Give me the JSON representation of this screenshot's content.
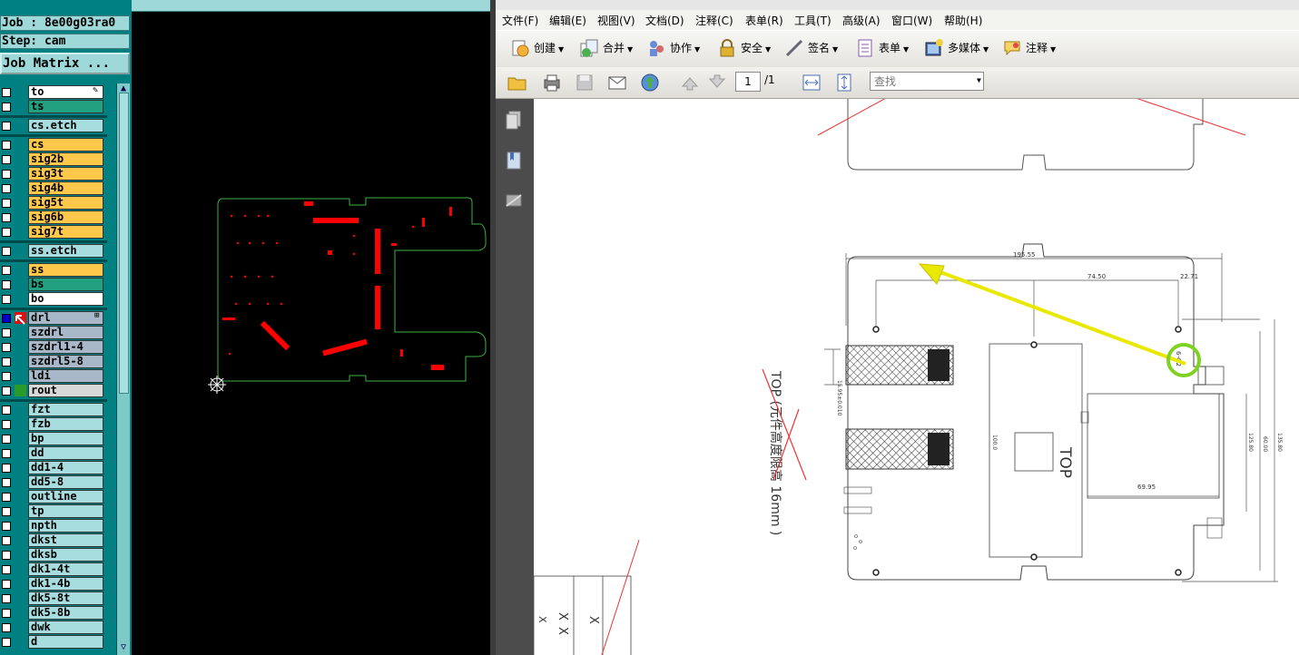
{
  "cam": {
    "job_label": "Job : 8e00g03ra0",
    "step_label": "Step: cam",
    "job_matrix_button": "Job Matrix ...",
    "layers": [
      {
        "name": "to",
        "color": "#ffffff",
        "checked": false,
        "extra": "pencil"
      },
      {
        "name": "ts",
        "color": "#22a080",
        "checked": false
      },
      {
        "name": "cs.etch",
        "color": "#a8dde0",
        "checked": false
      },
      {
        "name": "cs",
        "color": "#ffc84a",
        "checked": false
      },
      {
        "name": "sig2b",
        "color": "#ffc84a",
        "checked": false
      },
      {
        "name": "sig3t",
        "color": "#ffc84a",
        "checked": false
      },
      {
        "name": "sig4b",
        "color": "#ffc84a",
        "checked": false
      },
      {
        "name": "sig5t",
        "color": "#ffc84a",
        "checked": false
      },
      {
        "name": "sig6b",
        "color": "#ffc84a",
        "checked": false
      },
      {
        "name": "sig7t",
        "color": "#ffc84a",
        "checked": false
      },
      {
        "name": "ss.etch",
        "color": "#a8dde0",
        "checked": false
      },
      {
        "name": "ss",
        "color": "#ffc84a",
        "checked": false
      },
      {
        "name": "bs",
        "color": "#22a080",
        "checked": false
      },
      {
        "name": "bo",
        "color": "#ffffff",
        "checked": false
      },
      {
        "name": "drl",
        "color": "#a8b8c8",
        "checked": true,
        "extra": "grid"
      },
      {
        "name": "szdrl",
        "color": "#a8b8c8",
        "checked": false
      },
      {
        "name": "szdrl1-4",
        "color": "#a8b8c8",
        "checked": false
      },
      {
        "name": "szdrl5-8",
        "color": "#a8b8c8",
        "checked": false
      },
      {
        "name": "ldi",
        "color": "#a8b8c8",
        "checked": false
      },
      {
        "name": "rout",
        "color": "#d8d8d8",
        "checked": false
      },
      {
        "name": "fzt",
        "color": "#a8dde0",
        "checked": false
      },
      {
        "name": "fzb",
        "color": "#a8dde0",
        "checked": false
      },
      {
        "name": "bp",
        "color": "#a8dde0",
        "checked": false
      },
      {
        "name": "dd",
        "color": "#a8dde0",
        "checked": false
      },
      {
        "name": "dd1-4",
        "color": "#a8dde0",
        "checked": false
      },
      {
        "name": "dd5-8",
        "color": "#a8dde0",
        "checked": false
      },
      {
        "name": "outline",
        "color": "#a8dde0",
        "checked": false
      },
      {
        "name": "tp",
        "color": "#a8dde0",
        "checked": false
      },
      {
        "name": "npth",
        "color": "#a8dde0",
        "checked": false
      },
      {
        "name": "dkst",
        "color": "#a8dde0",
        "checked": false
      },
      {
        "name": "dksb",
        "color": "#a8dde0",
        "checked": false
      },
      {
        "name": "dk1-4t",
        "color": "#a8dde0",
        "checked": false
      },
      {
        "name": "dk1-4b",
        "color": "#a8dde0",
        "checked": false
      },
      {
        "name": "dk5-8t",
        "color": "#a8dde0",
        "checked": false
      },
      {
        "name": "dk5-8b",
        "color": "#a8dde0",
        "checked": false
      },
      {
        "name": "dwk",
        "color": "#a8dde0",
        "checked": false
      },
      {
        "name": "d",
        "color": "#a8dde0",
        "checked": false
      }
    ]
  },
  "acrobat": {
    "menu": [
      "文件(F)",
      "编辑(E)",
      "视图(V)",
      "文档(D)",
      "注释(C)",
      "表单(R)",
      "工具(T)",
      "高级(A)",
      "窗口(W)",
      "帮助(H)"
    ],
    "toolbar": [
      {
        "label": "创建",
        "icon": "create-icon"
      },
      {
        "label": "合并",
        "icon": "combine-icon"
      },
      {
        "label": "协作",
        "icon": "collaborate-icon"
      },
      {
        "label": "安全",
        "icon": "lock-icon"
      },
      {
        "label": "签名",
        "icon": "pen-icon"
      },
      {
        "label": "表单",
        "icon": "form-icon"
      },
      {
        "label": "多媒体",
        "icon": "multimedia-icon"
      },
      {
        "label": "注释",
        "icon": "comment-icon"
      }
    ],
    "page_current": "1",
    "page_total": "/1",
    "find_placeholder": "查找"
  },
  "drawing": {
    "dim_top": "195.55",
    "dim_mid": "74.50",
    "dim_right": "22.71",
    "dim_inner": "69.95",
    "hole_note": "6-Φ2",
    "top_text": "TOP",
    "left_note": "TOP (元件高度限高 16mm )",
    "dim_left": "15.95±0.010",
    "dim_v1": "100.0",
    "dim_v2": "125.80",
    "dim_v3": "135.80",
    "dim_v4": "60.00",
    "title_marks": [
      "X",
      "X",
      "X",
      "X"
    ]
  },
  "colors": {
    "cam_bg": "#008080",
    "cam_panel": "#9ed8d8",
    "pcb_outline": "#3cb043",
    "pcb_pads": "#ff0000",
    "arrow": "#e8e800",
    "circle": "#7ed321"
  }
}
